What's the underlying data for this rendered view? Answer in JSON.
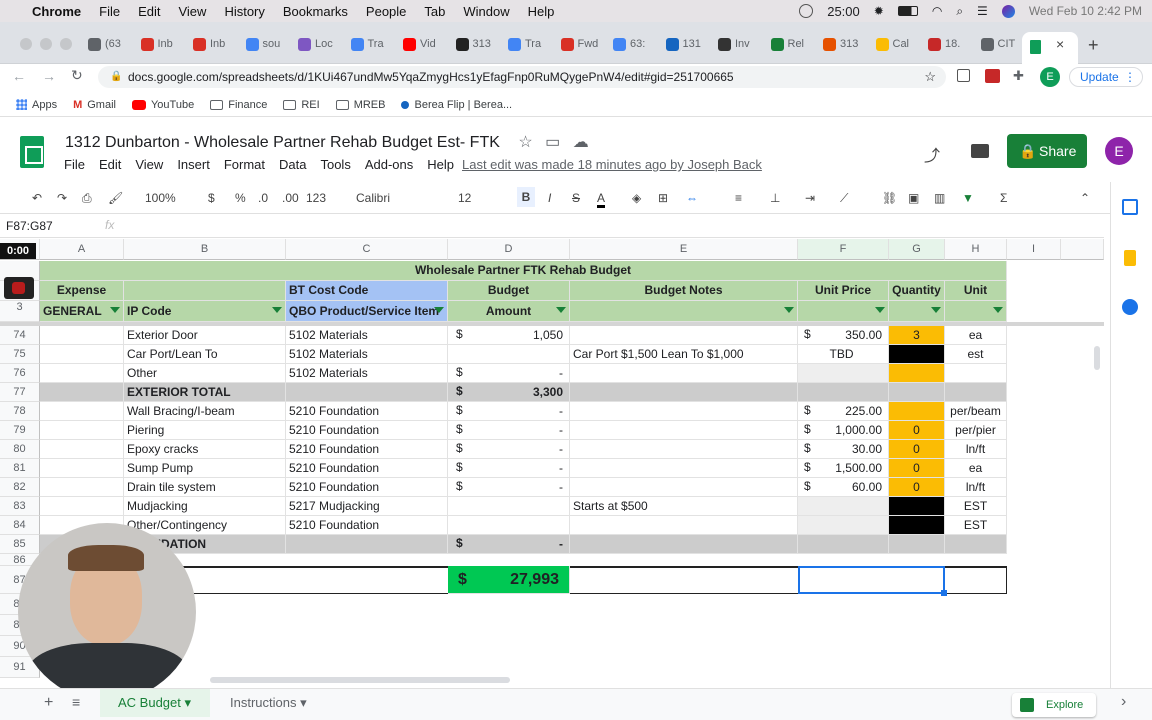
{
  "menubar": {
    "app": "Chrome",
    "items": [
      "File",
      "Edit",
      "View",
      "History",
      "Bookmarks",
      "People",
      "Tab",
      "Window",
      "Help"
    ],
    "timer": "25:00",
    "datetime": "Wed Feb 10  2:42 PM"
  },
  "tabs": [
    "(63",
    "Inb",
    "Inb",
    "sou",
    "Loc",
    "Tra",
    "Vid",
    "313",
    "Tra",
    "Fwd",
    "63:",
    "131",
    "Inv",
    "Rel",
    "313",
    "Cal",
    "18.",
    "CIT"
  ],
  "address": {
    "url": "docs.google.com/spreadsheets/d/1KUi467undMw5YqaZmygHcs1yEfagFnp0RuMQygePnW4/edit#gid=251700665",
    "update": "Update",
    "profile": "E"
  },
  "bookmarks": [
    "Apps",
    "Gmail",
    "YouTube",
    "Finance",
    "REI",
    "MREB",
    "Berea Flip | Berea..."
  ],
  "doc": {
    "title": "1312 Dunbarton - Wholesale Partner Rehab Budget Est- FTK",
    "menus": [
      "File",
      "Edit",
      "View",
      "Insert",
      "Format",
      "Data",
      "Tools",
      "Add-ons",
      "Help"
    ],
    "last_edit": "Last edit was made 18 minutes ago by Joseph Back",
    "share": "Share",
    "avatar": "E"
  },
  "toolbar": {
    "zoom": "100%",
    "currency": "$",
    "percent": "%",
    "dec_less": ".0",
    "dec_more": ".00",
    "format": "123",
    "font": "Calibri",
    "size": "12",
    "bold": "B",
    "italic": "I",
    "strike": "S",
    "textcolor": "A"
  },
  "formula": {
    "namebox": "F87:G87",
    "fx": "fx"
  },
  "recorder": {
    "timer": "0:00"
  },
  "columns": [
    "A",
    "B",
    "C",
    "D",
    "E",
    "F",
    "G",
    "H",
    "I"
  ],
  "header": {
    "banner": "Wholesale Partner FTK Rehab Budget",
    "expense": "Expense",
    "bt": "BT Cost Code",
    "budget": "Budget",
    "notes": "Budget Notes",
    "unit_price": "Unit Price",
    "quantity": "Quantity",
    "unit": "Unit",
    "general": "GENERAL",
    "ip": "IP Code",
    "qbo": "QBO Product/Service Item",
    "amount": "Amount",
    "row3": "3"
  },
  "rows": [
    {
      "n": "74",
      "b": "Exterior Door",
      "c": "5102 Materials",
      "d_cur": "$",
      "d": "1,050",
      "e": "",
      "f_cur": "$",
      "f": "350.00",
      "g": "3",
      "h": "ea",
      "gcolor": "orange"
    },
    {
      "n": "75",
      "b": "Car Port/Lean To",
      "c": "5102 Materials",
      "d_cur": "",
      "d": "",
      "e": "Car Port $1,500 Lean To $1,000",
      "f_cur": "",
      "f": "TBD",
      "g": "",
      "h": "est",
      "gcolor": "black"
    },
    {
      "n": "76",
      "b": "Other",
      "c": "5102 Materials",
      "d_cur": "$",
      "d": "-",
      "e": "",
      "f_cur": "",
      "f": "",
      "g": "",
      "h": "",
      "gcolor": "orange"
    },
    {
      "n": "77",
      "b": "EXTERIOR TOTAL",
      "c": "",
      "d_cur": "$",
      "d": "3,300",
      "e": "",
      "f_cur": "",
      "f": "",
      "g": "",
      "h": "",
      "total": true
    },
    {
      "n": "78",
      "b": "Wall Bracing/I-beam",
      "c": "5210 Foundation",
      "d_cur": "$",
      "d": "-",
      "e": "",
      "f_cur": "$",
      "f": "225.00",
      "g": "",
      "h": "per/beam",
      "gcolor": "orange"
    },
    {
      "n": "79",
      "b": "Piering",
      "c": "5210 Foundation",
      "d_cur": "$",
      "d": "-",
      "e": "",
      "f_cur": "$",
      "f": "1,000.00",
      "g": "0",
      "h": "per/pier",
      "gcolor": "orange"
    },
    {
      "n": "80",
      "b": "Epoxy cracks",
      "c": "5210 Foundation",
      "d_cur": "$",
      "d": "-",
      "e": "",
      "f_cur": "$",
      "f": "30.00",
      "g": "0",
      "h": "ln/ft",
      "gcolor": "orange"
    },
    {
      "n": "81",
      "b": "Sump Pump",
      "c": "5210 Foundation",
      "d_cur": "$",
      "d": "-",
      "e": "",
      "f_cur": "$",
      "f": "1,500.00",
      "g": "0",
      "h": "ea",
      "gcolor": "orange"
    },
    {
      "n": "82",
      "b": "Drain tile system",
      "c": "5210 Foundation",
      "d_cur": "$",
      "d": "-",
      "e": "",
      "f_cur": "$",
      "f": "60.00",
      "g": "0",
      "h": "ln/ft",
      "gcolor": "orange"
    },
    {
      "n": "83",
      "b": "Mudjacking",
      "c": "5217 Mudjacking",
      "d_cur": "",
      "d": "",
      "e": "Starts at $500",
      "f_cur": "",
      "f": "",
      "g": "",
      "h": "EST",
      "gcolor": "black"
    },
    {
      "n": "84",
      "b": "Other/Contingency",
      "c": "5210 Foundation",
      "d_cur": "",
      "d": "",
      "e": "",
      "f_cur": "",
      "f": "",
      "g": "",
      "h": "EST",
      "gcolor": "black"
    },
    {
      "n": "85",
      "b": "FOUNDATION",
      "c": "",
      "d_cur": "$",
      "d": "-",
      "e": "",
      "f_cur": "",
      "f": "",
      "g": "",
      "h": "",
      "total": true
    }
  ],
  "grand_total": {
    "cur": "$",
    "value": "27,993"
  },
  "row_nums_after": [
    "86",
    "87",
    "88",
    "89",
    "90",
    "91"
  ],
  "sheets": {
    "active": "AC Budget",
    "other": "Instructions",
    "explore": "Explore"
  },
  "colors": {
    "green": "#b6d7a8",
    "total_gray": "#cccccc",
    "qty_orange": "#fbbc04",
    "grand_total": "#00c853",
    "share": "#188038"
  }
}
